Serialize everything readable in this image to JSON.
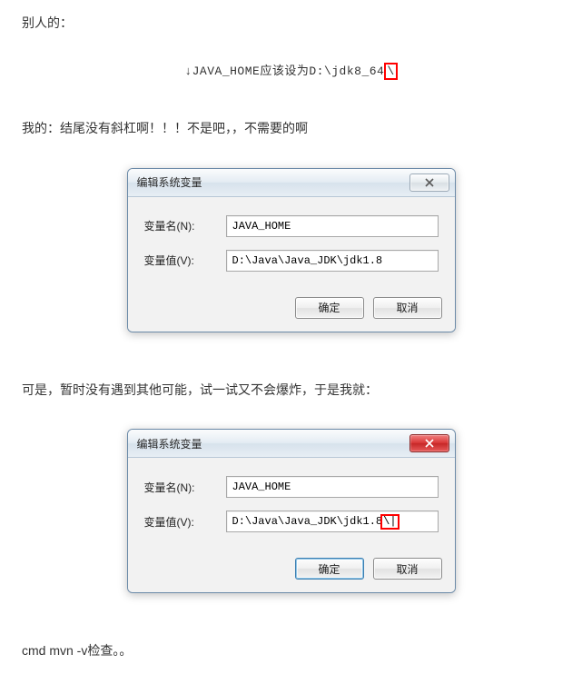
{
  "text": {
    "p1": "别人的：",
    "code_small_prefix": "↓JAVA_HOME应该设为D:\\jdk8_64",
    "code_small_boxed": "\\",
    "p2": "我的：结尾没有斜杠啊！！！不是吧，，不需要的啊",
    "p3": "可是，暂时没有遇到其他可能，试一试又不会爆炸，于是我就：",
    "p4": "cmd mvn -v检查。。"
  },
  "dialog1": {
    "title": "编辑系统变量",
    "name_label": "变量名(N):",
    "name_value": "JAVA_HOME",
    "value_label": "变量值(V):",
    "value_value": "D:\\Java\\Java_JDK\\jdk1.8",
    "ok": "确定",
    "cancel": "取消"
  },
  "dialog2": {
    "title": "编辑系统变量",
    "name_label": "变量名(N):",
    "name_value": "JAVA_HOME",
    "value_label": "变量值(V):",
    "value_value_prefix": "D:\\Java\\Java_JDK\\jdk1.8",
    "value_value_boxed": "\\|",
    "ok": "确定",
    "cancel": "取消"
  }
}
